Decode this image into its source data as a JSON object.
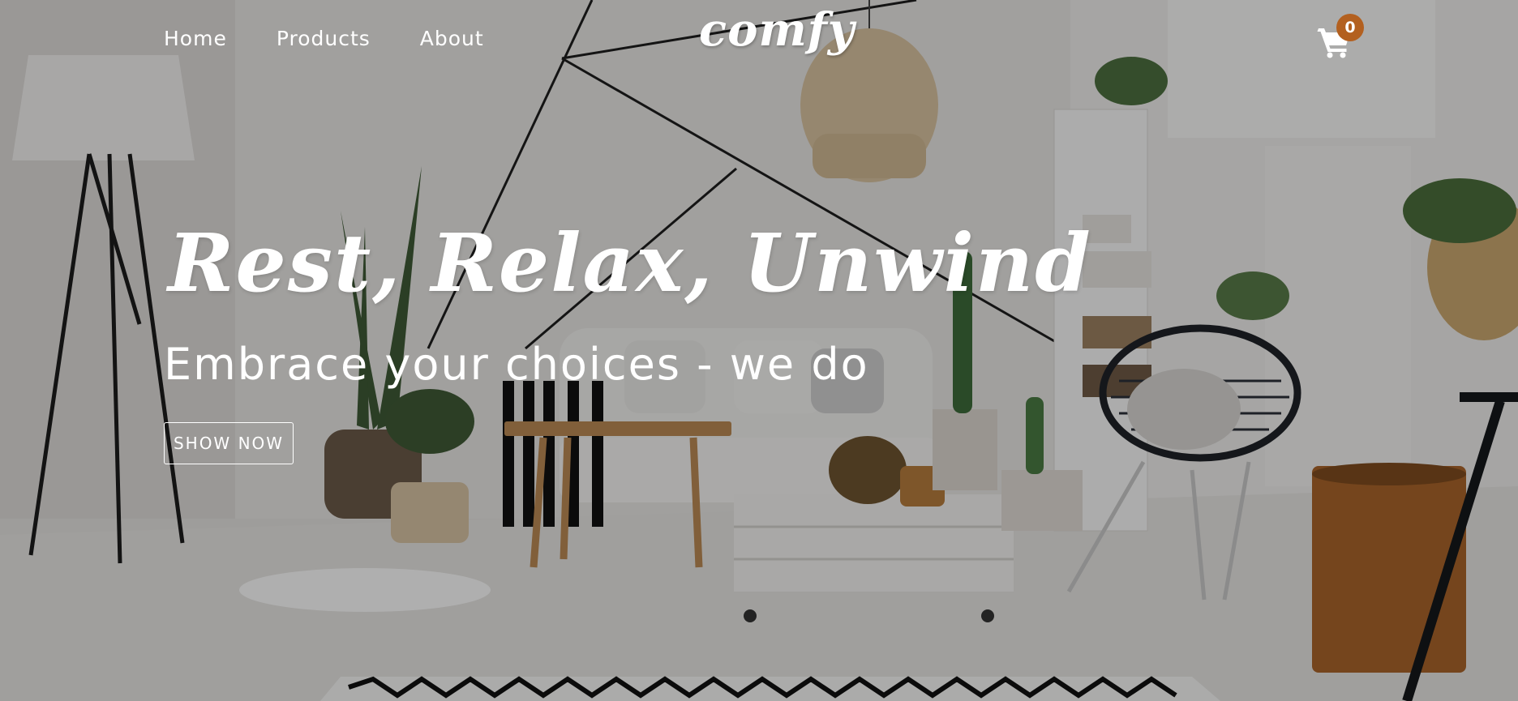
{
  "nav": {
    "links": [
      {
        "label": "Home"
      },
      {
        "label": "Products"
      },
      {
        "label": "About"
      }
    ],
    "logo": "comfy",
    "cart": {
      "icon": "shopping-cart-icon",
      "count": "0"
    }
  },
  "hero": {
    "title": "Rest, Relax, Unwind",
    "subtitle": "Embrace your choices - we do",
    "button_label": "SHOW NOW"
  },
  "colors": {
    "badge": "#b3601f",
    "text": "#ffffff",
    "overlay": "rgba(0,0,0,0.30)"
  }
}
